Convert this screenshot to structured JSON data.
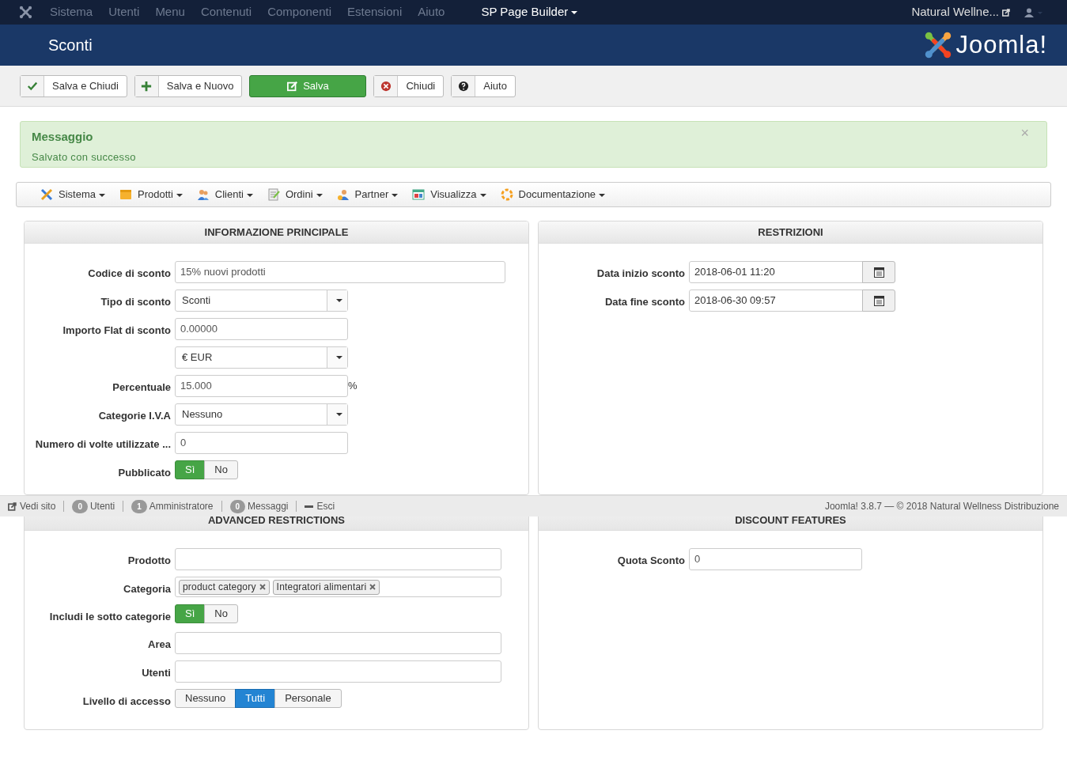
{
  "topbar": {
    "menu": [
      {
        "label": "Sistema",
        "highlight": false
      },
      {
        "label": "Utenti",
        "highlight": false
      },
      {
        "label": "Menu",
        "highlight": false
      },
      {
        "label": "Contenuti",
        "highlight": false
      },
      {
        "label": "Componenti",
        "highlight": false
      },
      {
        "label": "Estensioni",
        "highlight": false
      },
      {
        "label": "Aiuto",
        "highlight": false
      },
      {
        "label": "SP Page Builder",
        "highlight": true
      }
    ],
    "site": "Natural Wellne..."
  },
  "header": {
    "title": "Sconti",
    "logo": "Joomla!"
  },
  "toolbar": [
    {
      "label": "Salva e Chiudi",
      "kind": "check"
    },
    {
      "label": "Salva e Nuovo",
      "kind": "plus"
    },
    {
      "label": "Salva",
      "kind": "primary"
    },
    {
      "label": "Chiudi",
      "kind": "close"
    },
    {
      "label": "Aiuto",
      "kind": "help"
    }
  ],
  "alert": {
    "title": "Messaggio",
    "text": "Salvato con successo",
    "close": "×"
  },
  "submenu": [
    {
      "label": "Sistema",
      "kind": "tools"
    },
    {
      "label": "Prodotti",
      "kind": "box"
    },
    {
      "label": "Clienti",
      "kind": "users"
    },
    {
      "label": "Ordini",
      "kind": "doc"
    },
    {
      "label": "Partner",
      "kind": "partner"
    },
    {
      "label": "Visualizza",
      "kind": "window"
    },
    {
      "label": "Documentazione",
      "kind": "lifebuoy"
    }
  ],
  "panels": [
    {
      "title": "INFORMAZIONE PRINCIPALE",
      "fields": [
        {
          "label": "Codice di sconto",
          "kind": "wide_text",
          "value": "15% nuovi prodotti"
        },
        {
          "label": "Tipo di sconto",
          "kind": "select",
          "value": "Sconti"
        },
        {
          "label": "Importo Flat di sconto",
          "kind": "text",
          "value": "0.00000"
        },
        {
          "kind": "select",
          "value": "€ EUR"
        },
        {
          "label": "Percentuale",
          "kind": "text",
          "value": "15.000",
          "suffix": "%"
        },
        {
          "label": "Categorie I.V.A",
          "kind": "select",
          "value": "Nessuno"
        },
        {
          "label": "Numero di volte utilizzate ...",
          "kind": "text",
          "value": "0"
        },
        {
          "label": "Pubblicato",
          "kind": "yes_no",
          "options": [
            {
              "label": "Sì",
              "selected": true
            },
            {
              "label": "No",
              "selected": false
            }
          ]
        }
      ]
    },
    {
      "title": "RESTRIZIONI",
      "fields": [
        {
          "label": "Data inizio sconto",
          "kind": "date",
          "value": "2018-06-01 11:20"
        },
        {
          "label": "Data fine sconto",
          "kind": "date",
          "value": "2018-06-30 09:57"
        }
      ]
    },
    {
      "title": "ADVANCED RESTRICTIONS",
      "fields": [
        {
          "label": "Prodotto",
          "kind": "wide_text"
        },
        {
          "label": "Categoria",
          "kind": "tags",
          "tags": [
            "product category",
            "Integratori alimentari"
          ]
        },
        {
          "label": "Includi le sotto categorie",
          "kind": "yes_no",
          "options": [
            {
              "label": "Sì",
              "selected": true
            },
            {
              "label": "No",
              "selected": false
            }
          ]
        },
        {
          "label": "Area",
          "kind": "wide_text"
        },
        {
          "label": "Utenti",
          "kind": "wide_text"
        },
        {
          "label": "Livello di accesso",
          "kind": "segmented",
          "options": [
            {
              "label": "Nessuno",
              "selected": false
            },
            {
              "label": "Tutti",
              "selected": true
            },
            {
              "label": "Personale",
              "selected": false
            }
          ]
        }
      ]
    },
    {
      "title": "DISCOUNT FEATURES",
      "fields": [
        {
          "label": "Quota Sconto",
          "kind": "text",
          "value": "0"
        }
      ]
    }
  ],
  "status_bar": {
    "view_site": "Vedi sito",
    "counters": [
      {
        "count": "0",
        "label": "Utenti"
      },
      {
        "count": "1",
        "label": "Amministratore"
      },
      {
        "count": "0",
        "label": "Messaggi"
      }
    ],
    "logout": "Esci",
    "copyright": "Joomla! 3.8.7 — © 2018 Natural Wellness Distribuzione"
  }
}
